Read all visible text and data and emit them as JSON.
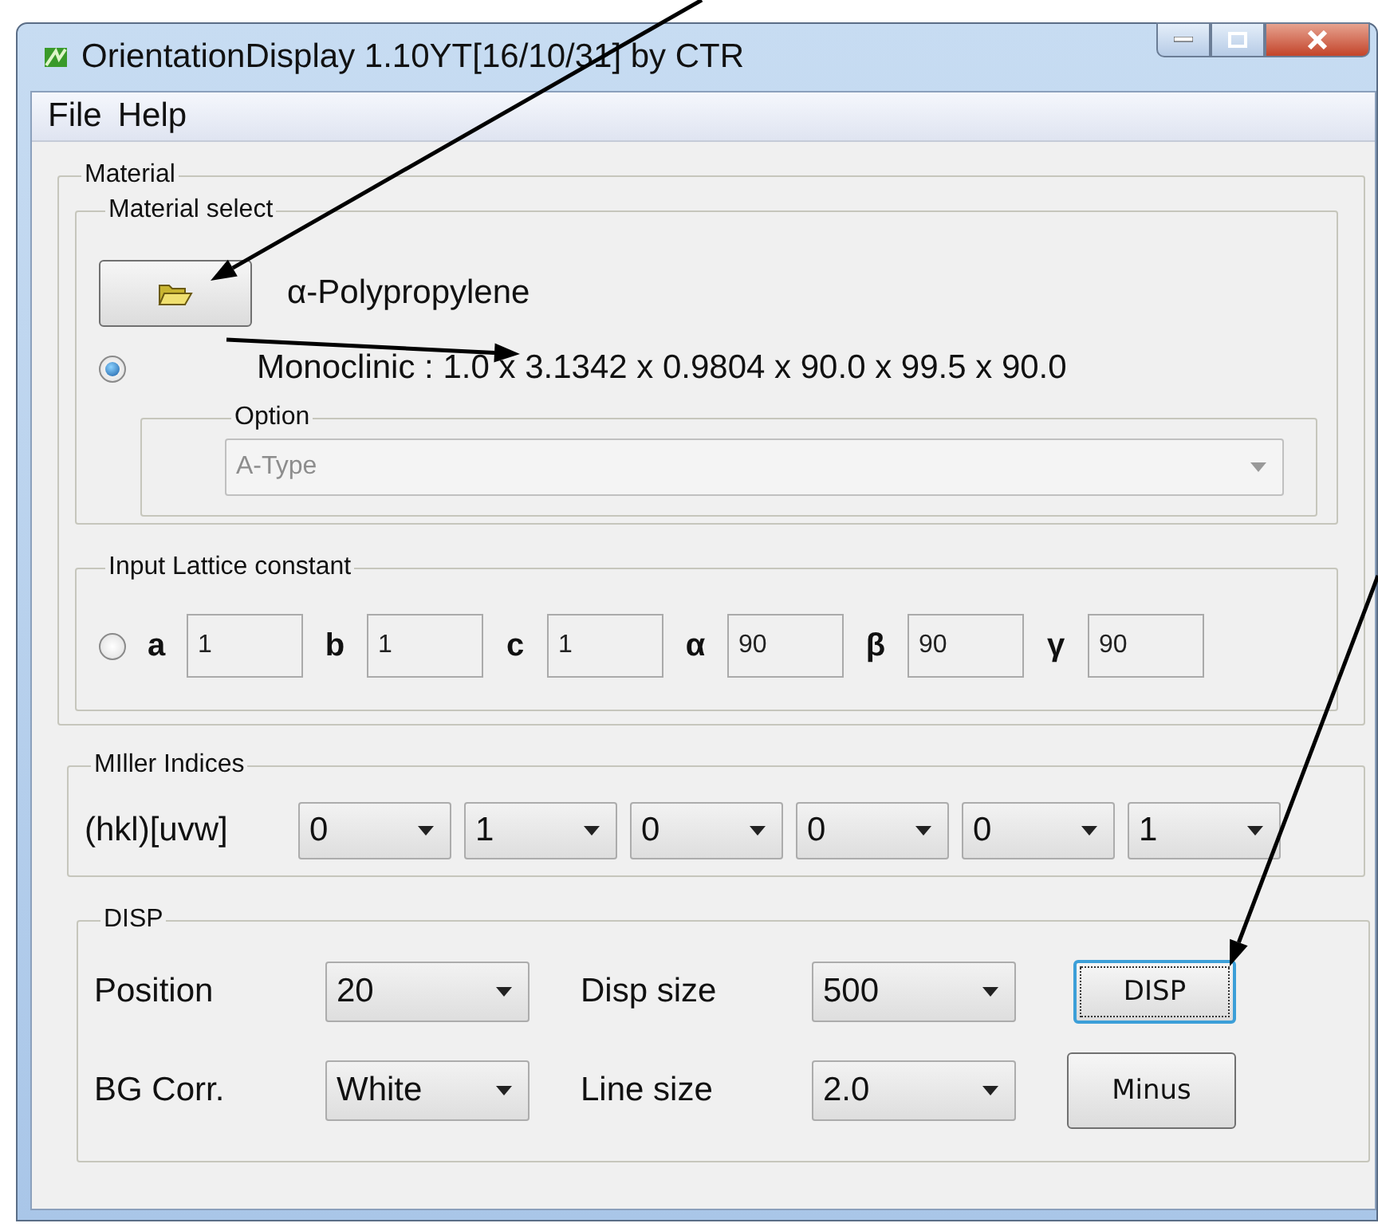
{
  "window": {
    "title": "OrientationDisplay 1.10YT[16/10/31] by CTR"
  },
  "menu": [
    "File",
    "Help"
  ],
  "material": {
    "legend": "Material",
    "select": {
      "legend": "Material select",
      "material_name": "α-Polypropylene",
      "selected": true,
      "crystal_text": "Monoclinic : 1.0 x 3.1342 x 0.9804 x 90.0 x 99.5 x 90.0",
      "option": {
        "legend": "Option",
        "value": "A-Type",
        "disabled": true
      }
    },
    "lattice": {
      "legend": "Input Lattice constant",
      "selected": false,
      "params": [
        {
          "symbol": "a",
          "value": "1"
        },
        {
          "symbol": "b",
          "value": "1"
        },
        {
          "symbol": "c",
          "value": "1"
        },
        {
          "symbol": "α",
          "value": "90"
        },
        {
          "symbol": "β",
          "value": "90"
        },
        {
          "symbol": "γ",
          "value": "90"
        }
      ]
    }
  },
  "miller": {
    "legend": "MIller Indices",
    "label": "(hkl)[uvw]",
    "indices": [
      "0",
      "1",
      "0",
      "0",
      "0",
      "1"
    ]
  },
  "disp": {
    "legend": "DISP",
    "settings": [
      {
        "label": "Position",
        "value": "20"
      },
      {
        "label": "Disp size",
        "value": "500"
      },
      {
        "label": "BG Corr.",
        "value": "White"
      },
      {
        "label": "Line size",
        "value": "2.0"
      }
    ],
    "buttons": [
      {
        "label": "DISP",
        "focused": true
      },
      {
        "label": "Minus",
        "focused": false
      }
    ]
  }
}
